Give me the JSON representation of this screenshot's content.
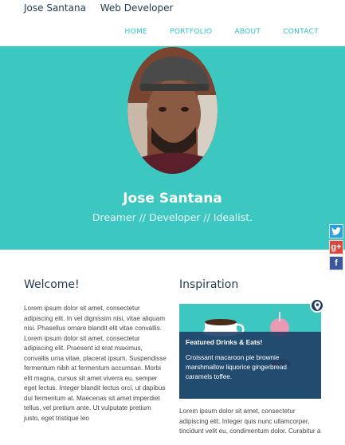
{
  "header": {
    "name": "Jose Santana",
    "role": "Web Developer"
  },
  "nav": [
    {
      "label": "HOME"
    },
    {
      "label": "PORTFOLIO"
    },
    {
      "label": "ABOUT"
    },
    {
      "label": "CONTACT"
    }
  ],
  "hero": {
    "name": "Jose Santana",
    "tagline": "Dreamer // Developer // Idealist."
  },
  "social": [
    {
      "icon": "twitter-icon"
    },
    {
      "icon": "google-plus-icon",
      "label": "g+"
    },
    {
      "icon": "facebook-icon",
      "label": "f"
    }
  ],
  "welcome": {
    "title": "Welcome!",
    "body": "Lorem ipsum dolor sit amet, consectetur adipiscing elit. In vel dignissim nisi, vitae aliquam nisi. Phasellus ornare blandit elit vitae convallis. Lorem ipsum dolor sit amet, consectetur adipiscing elit. Praesent id erat maximus, convallis urna vitae, placerat ipsum. Suspendisse fermentum nibh at fermentum accumsan. Morbi elit magna, cursus sit amet viverra eu, semper eget lectus. Integer blandit lectus orci, ut dapibus dui fermentum at. Maecenas sit amet imperdiet tellus, vel pretium ante. Ut vulputate pretium justo, eget tristique leo"
  },
  "inspiration": {
    "title": "Inspiration",
    "card_title": "Featured Drinks & Eats!",
    "card_text": "Croissant macaroon pie brownie marshmallow liquorice gingerbread caramels toffee.",
    "body": "Lorem ipsum dolor sit amet, consectetur adipiscing elit. Integer quis nunc ullamcorper, tincidunt velit eu, condimentum dolor. Curabitur a"
  }
}
